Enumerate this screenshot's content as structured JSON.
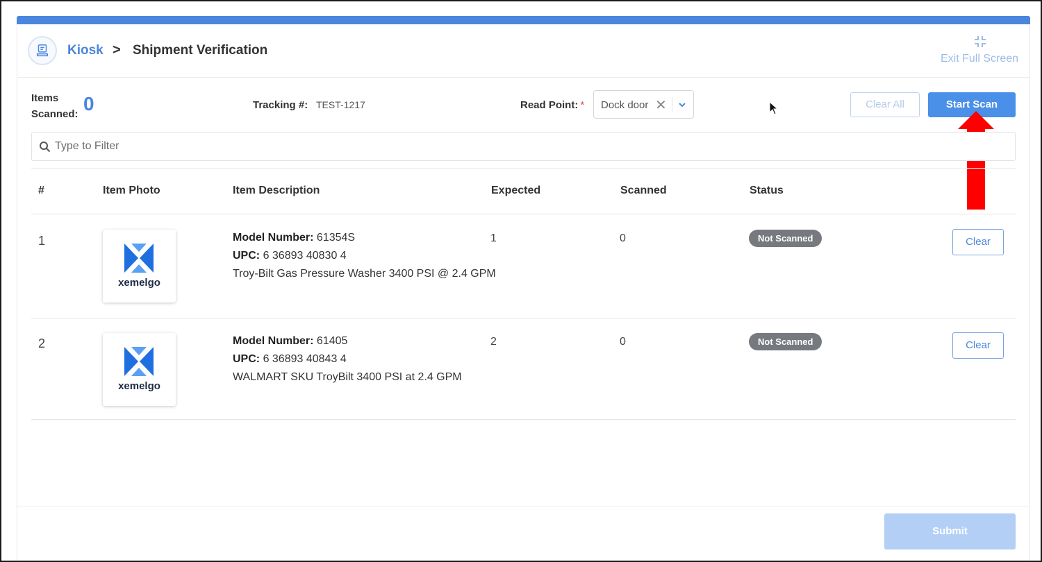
{
  "breadcrumb": {
    "root": "Kiosk",
    "separator": ">",
    "current": "Shipment Verification"
  },
  "header": {
    "exit_fullscreen_label": "Exit Full Screen",
    "exit_fullscreen_icon": "compress-icon",
    "kiosk_icon": "kiosk-device-icon"
  },
  "summary": {
    "items_scanned_label": "Items Scanned:",
    "items_scanned_count": "0",
    "tracking_label": "Tracking #:",
    "tracking_value": "TEST-1217",
    "read_point_label": "Read Point:",
    "read_point_required": "*",
    "read_point_value": "Dock door",
    "read_point_clear": "✕"
  },
  "actions": {
    "clear_all_label": "Clear All",
    "start_scan_label": "Start Scan",
    "submit_label": "Submit"
  },
  "filter": {
    "placeholder": "Type to Filter",
    "icon": "search-icon"
  },
  "table": {
    "headers": [
      "#",
      "Item Photo",
      "Item Description",
      "Expected",
      "Scanned",
      "Status"
    ],
    "rows": [
      {
        "index": "1",
        "photo_brand": "xemelgo",
        "model_label": "Model Number:",
        "model_value": "61354S",
        "upc_label": "UPC:",
        "upc_value": "6 36893 40830 4",
        "description": "Troy-Bilt Gas Pressure Washer 3400 PSI @ 2.4 GPM",
        "expected": "1",
        "scanned": "0",
        "status": "Not Scanned",
        "clear_label": "Clear"
      },
      {
        "index": "2",
        "photo_brand": "xemelgo",
        "model_label": "Model Number:",
        "model_value": "61405",
        "upc_label": "UPC:",
        "upc_value": "6 36893 40843 4",
        "description": "WALMART SKU TroyBilt 3400 PSI at 2.4 GPM",
        "expected": "2",
        "scanned": "0",
        "status": "Not Scanned",
        "clear_label": "Clear"
      }
    ]
  },
  "colors": {
    "accent": "#4a86de",
    "primary_button": "#4a8fe8",
    "badge": "#76797e",
    "annotation_arrow": "#ff0000",
    "submit_disabled": "#b3cff6"
  }
}
